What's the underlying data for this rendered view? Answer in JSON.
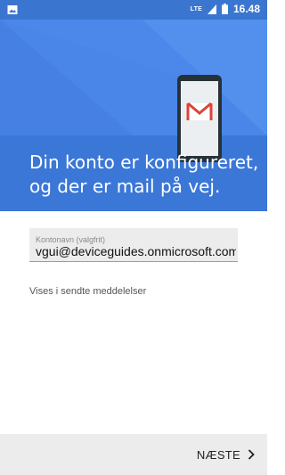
{
  "status_bar": {
    "network": "LTE",
    "time": "16.48",
    "icons": [
      "image-notification-icon",
      "signal-icon",
      "battery-icon"
    ]
  },
  "header": {
    "title": "Din konto er konfigureret, og der er mail på vej.",
    "colors": {
      "background": "#4a86e8",
      "status": "#3a76cf"
    }
  },
  "account_form": {
    "name_label": "Kontonavn (valgfrit)",
    "name_value": "vgui@deviceguides.onmicrosoft.com",
    "shown_in_sent": "Vises i sendte meddelelser"
  },
  "navigation": {
    "next_label": "NÆSTE"
  }
}
